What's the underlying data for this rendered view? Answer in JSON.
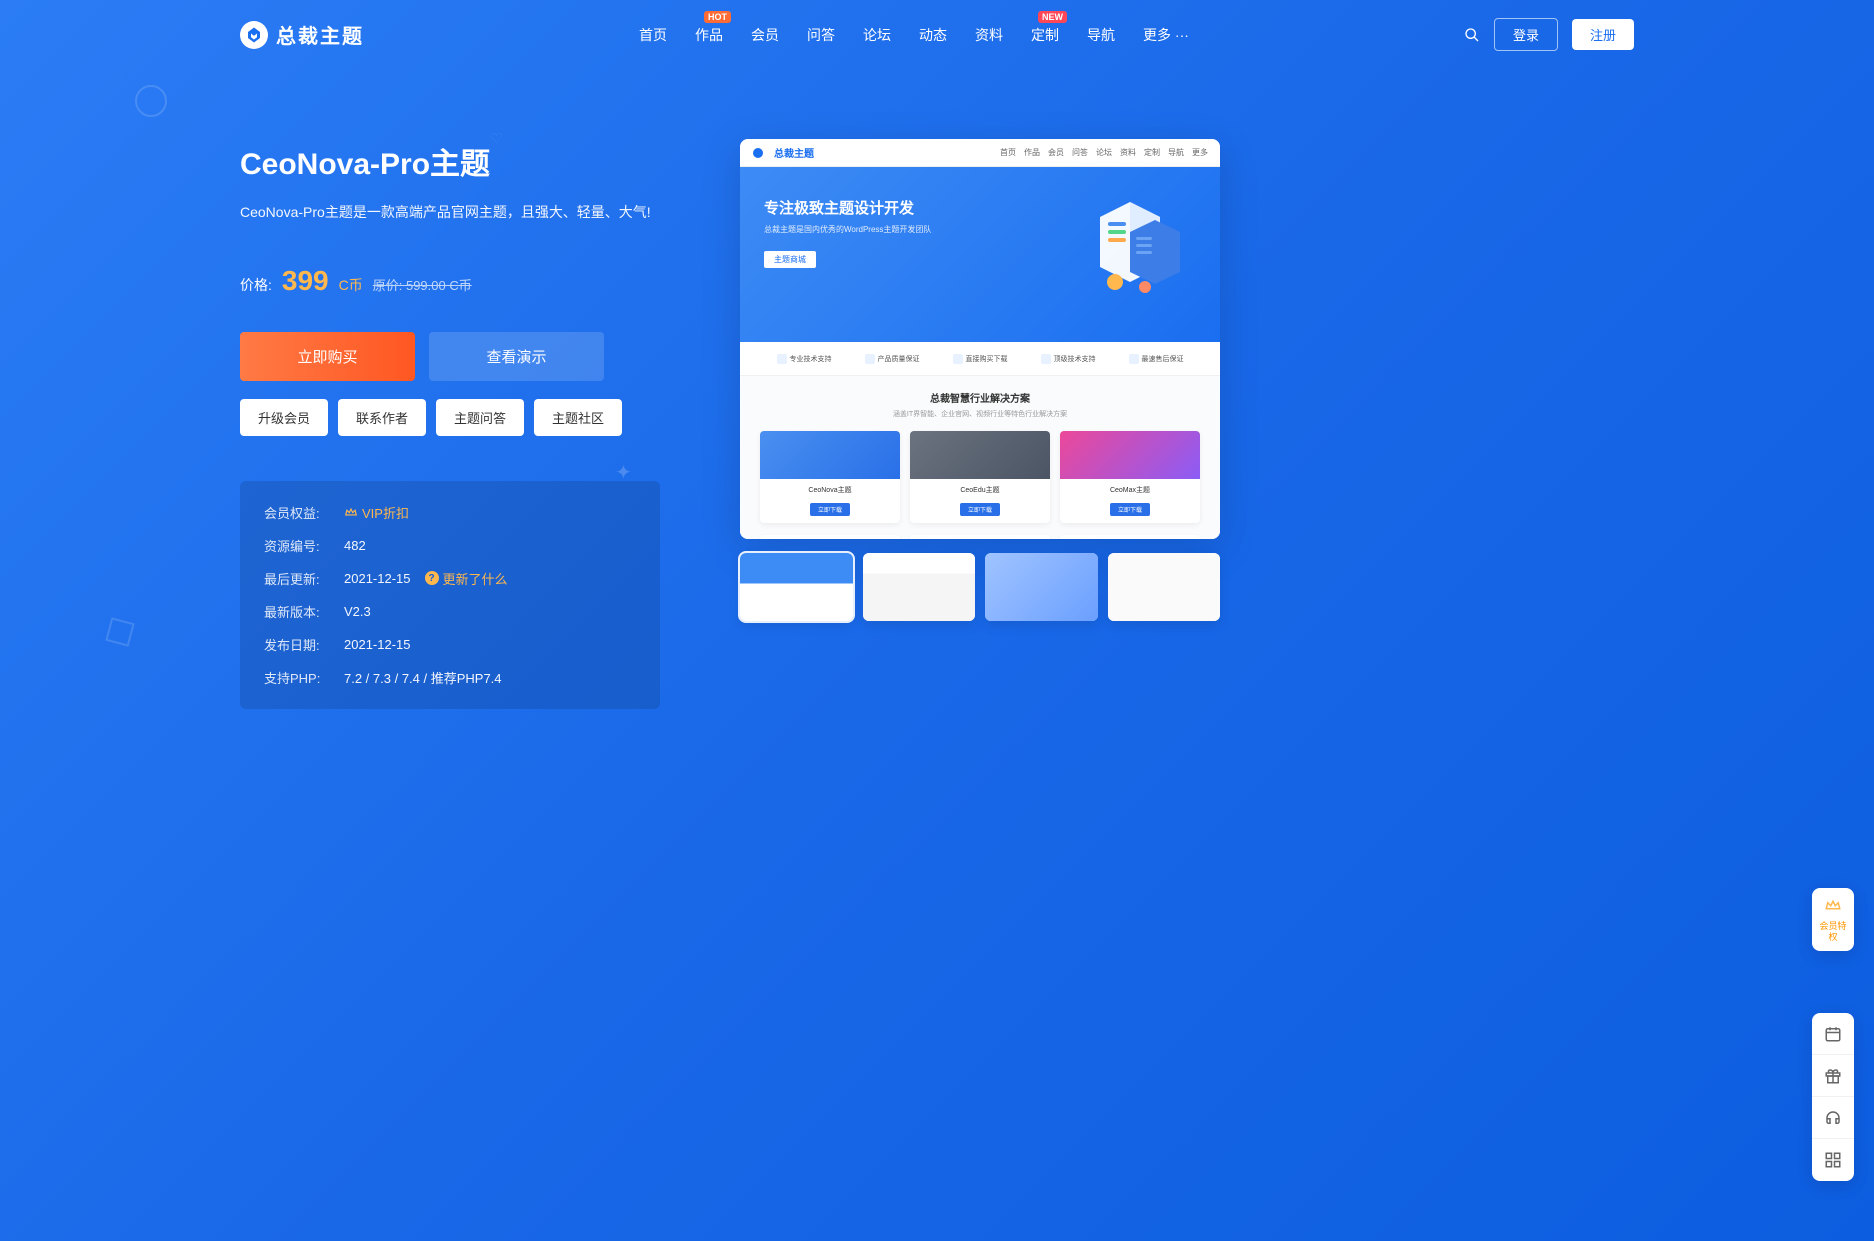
{
  "logo": {
    "text": "总裁主题"
  },
  "nav": {
    "items": [
      {
        "label": "首页",
        "badge": null
      },
      {
        "label": "作品",
        "badge": "HOT",
        "badgeClass": "badge-hot"
      },
      {
        "label": "会员",
        "badge": null
      },
      {
        "label": "问答",
        "badge": null
      },
      {
        "label": "论坛",
        "badge": null
      },
      {
        "label": "动态",
        "badge": null
      },
      {
        "label": "资料",
        "badge": null
      },
      {
        "label": "定制",
        "badge": "NEW",
        "badgeClass": "badge-new"
      },
      {
        "label": "导航",
        "badge": null
      },
      {
        "label": "更多 ···",
        "badge": null
      }
    ],
    "login": "登录",
    "register": "注册"
  },
  "product": {
    "title": "CeoNova-Pro主题",
    "desc": "CeoNova-Pro主题是一款高端产品官网主题，且强大、轻量、大气!",
    "price_label": "价格:",
    "price_value": "399",
    "price_unit": "C币",
    "price_orig": "原价:  599.00 C币",
    "buy": "立即购买",
    "demo": "查看演示",
    "links": [
      "升级会员",
      "联系作者",
      "主题问答",
      "主题社区"
    ]
  },
  "info": {
    "rows": [
      {
        "label": "会员权益:",
        "type": "vip",
        "value": "VIP折扣"
      },
      {
        "label": "资源编号:",
        "value": "482"
      },
      {
        "label": "最后更新:",
        "value": "2021-12-15",
        "type": "update",
        "update_text": "更新了什么"
      },
      {
        "label": "最新版本:",
        "value": "V2.3"
      },
      {
        "label": "发布日期:",
        "value": "2021-12-15"
      },
      {
        "label": "支持PHP:",
        "value": "7.2 / 7.3 / 7.4 / 推荐PHP7.4"
      }
    ]
  },
  "preview": {
    "logo": "总裁主题",
    "nav_items": [
      "首页",
      "作品",
      "会员",
      "问答",
      "论坛",
      "资料",
      "定制",
      "导航",
      "更多"
    ],
    "hero_title": "专注极致主题设计开发",
    "hero_sub": "总裁主题是国内优秀的WordPress主题开发团队",
    "hero_btn": "主题商城",
    "features": [
      "专业技术支持",
      "产品质量保证",
      "直接购买下载",
      "顶级技术支持",
      "最速售后保证"
    ],
    "section_title": "总裁智慧行业解决方案",
    "section_sub": "涵盖IT界智能、企业官网、视频行业等特色行业解决方案",
    "cards": [
      "CeoNova主题",
      "CeoEdu主题",
      "CeoMax主题"
    ]
  },
  "float_vip": {
    "text": "会员特权"
  }
}
